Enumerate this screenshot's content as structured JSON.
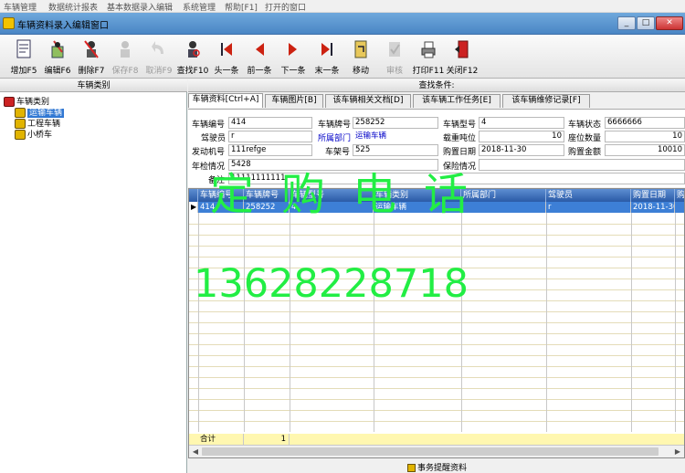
{
  "menu": [
    "车辆管理",
    "数据统计报表",
    "基本数据录入编辑",
    "系统管理",
    "帮助[F1]",
    "打开的窗口"
  ],
  "window": {
    "title": "车辆资料录入编辑窗口",
    "minimize": "_",
    "maximize": "□",
    "close": "✕"
  },
  "toolbar": [
    {
      "label": "增加F5",
      "icon": "add-document-icon",
      "enabled": true
    },
    {
      "label": "编辑F6",
      "icon": "edit-pencil-icon",
      "enabled": true
    },
    {
      "label": "删除F7",
      "icon": "delete-person-icon",
      "enabled": true
    },
    {
      "label": "保存F8",
      "icon": "save-icon",
      "enabled": false
    },
    {
      "label": "取消F9",
      "icon": "undo-icon",
      "enabled": false
    },
    {
      "label": "查找F10",
      "icon": "search-person-icon",
      "enabled": true
    },
    {
      "label": "头一条",
      "icon": "first-record-icon",
      "enabled": true
    },
    {
      "label": "前一条",
      "icon": "prev-record-icon",
      "enabled": true
    },
    {
      "label": "下一条",
      "icon": "next-record-icon",
      "enabled": true
    },
    {
      "label": "末一条",
      "icon": "last-record-icon",
      "enabled": true
    },
    {
      "label": "移动",
      "icon": "move-icon",
      "enabled": true
    },
    {
      "label": "审核",
      "icon": "approve-icon",
      "enabled": false
    },
    {
      "label": "打印F11",
      "icon": "print-icon",
      "enabled": true
    },
    {
      "label": "关闭F12",
      "icon": "exit-door-icon",
      "enabled": true
    }
  ],
  "left": {
    "header": "车辆类别",
    "tree": {
      "root": "车辆类别",
      "children": [
        "运输车辆",
        "工程车辆",
        "小桥车"
      ],
      "selected": "运输车辆"
    }
  },
  "right": {
    "search_label": "查找条件:",
    "tabs": [
      "车辆资料[Ctrl+A]",
      "车辆图片[B]",
      "该车辆相关文档[D]",
      "该车辆工作任务[E]",
      "该车辆维修记录[F]"
    ],
    "form": {
      "vehicle_no_label": "车辆编号",
      "vehicle_no": "414",
      "plate_label": "车辆牌号",
      "plate": "258252",
      "model_label": "车辆型号",
      "model": "4",
      "status_label": "车辆状态",
      "status": "6666666",
      "driver_label": "驾驶员",
      "driver": "r",
      "dept_label": "所属部门",
      "dept": "运输车辆",
      "tonnage_label": "载重吨位",
      "tonnage": "10",
      "seats_label": "座位数量",
      "seats": "10",
      "engine_label": "发动机号",
      "engine": "111refge",
      "frame_label": "车架号",
      "frame": "525",
      "purchase_date_label": "购置日期",
      "purchase_date": "2018-11-30",
      "price_label": "购置金额",
      "price": "10010",
      "inspection_label": "年检情况",
      "inspection": "5428",
      "insurance_label": "保险情况",
      "insurance": "",
      "remark_label": "备注",
      "remark": "11111111111"
    },
    "grid": {
      "columns": [
        "车辆编号",
        "车辆牌号",
        "车辆型号",
        "车辆类别",
        "所属部门",
        "驾驶员",
        "购置日期",
        "购"
      ],
      "rows": [
        [
          "414",
          "258252",
          "4",
          "运输车辆",
          "",
          "r",
          "2018-11-30",
          ""
        ]
      ],
      "total_label": "合计",
      "total_count": "1"
    },
    "bottom_button": "事务提醒资料"
  },
  "watermark": {
    "line1": "定购电话",
    "line2": "13628228718"
  },
  "colors": {
    "title_bar": "#4a86c5",
    "header_blue": "#2a5aa6",
    "selection": "#3d7fd6",
    "total_row": "#fff7b0",
    "watermark": "#22ee44",
    "dept_text": "#0000c8"
  }
}
